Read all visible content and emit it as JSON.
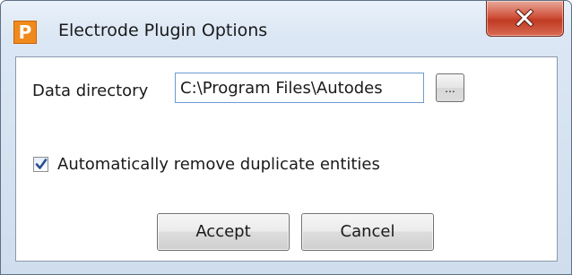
{
  "window": {
    "title": "Electrode Plugin Options",
    "icon_letter": "P",
    "icon": "app-plugin-icon",
    "close_icon": "close-icon"
  },
  "form": {
    "data_directory_label": "Data directory",
    "data_directory_value": "C:\\Program Files\\Autodes",
    "browse_label": "...",
    "remove_duplicates_label": "Automatically remove duplicate entities",
    "remove_duplicates_checked": true
  },
  "buttons": {
    "accept_label": "Accept",
    "cancel_label": "Cancel"
  },
  "colors": {
    "icon_orange": "#f08a1c",
    "close_red": "#c03b22",
    "input_border": "#6d9ad4",
    "frame_blue": "#dbe7f4"
  }
}
